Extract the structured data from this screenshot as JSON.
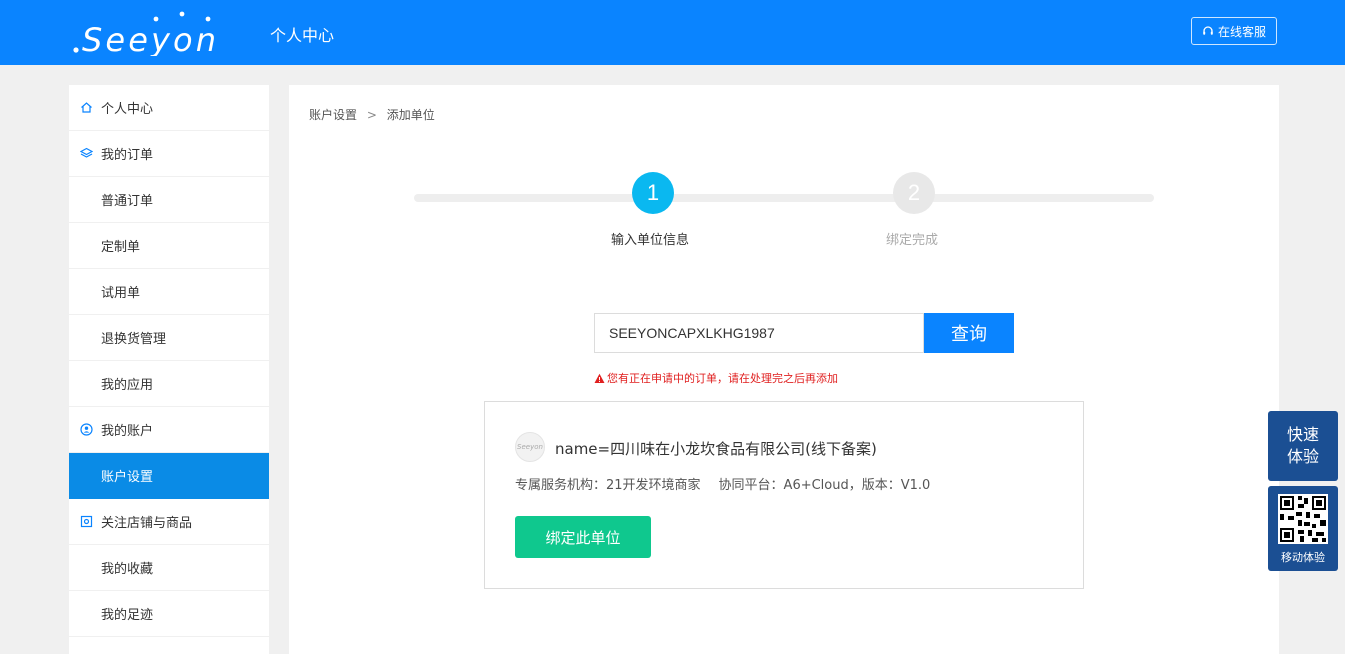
{
  "header": {
    "logo_text": ".Seeyon",
    "title": "个人中心",
    "support_label": "在线客服"
  },
  "sidebar": {
    "items": [
      {
        "label": "个人中心",
        "type": "group",
        "icon": "home-icon"
      },
      {
        "label": "我的订单",
        "type": "group",
        "icon": "layers-icon"
      },
      {
        "label": "普通订单",
        "type": "sub"
      },
      {
        "label": "定制单",
        "type": "sub"
      },
      {
        "label": "试用单",
        "type": "sub"
      },
      {
        "label": "退换货管理",
        "type": "sub"
      },
      {
        "label": "我的应用",
        "type": "sub"
      },
      {
        "label": "我的账户",
        "type": "group",
        "icon": "account-icon"
      },
      {
        "label": "账户设置",
        "type": "sub",
        "active": true
      },
      {
        "label": "关注店铺与商品",
        "type": "group",
        "icon": "store-icon"
      },
      {
        "label": "我的收藏",
        "type": "sub"
      },
      {
        "label": "我的足迹",
        "type": "sub"
      }
    ]
  },
  "breadcrumb": {
    "parent": "账户设置",
    "separator": ">",
    "current": "添加单位"
  },
  "steps": [
    {
      "number": "1",
      "label": "输入单位信息",
      "state": "active"
    },
    {
      "number": "2",
      "label": "绑定完成",
      "state": "pending"
    }
  ],
  "search": {
    "value": "SEEYONCAPXLKHG1987",
    "button_label": "查询"
  },
  "warning_text": "您有正在申请中的订单，请在处理完之后再添加",
  "result": {
    "logo_text": "Seeyon",
    "name": "name=四川味在小龙坎食品有限公司(线下备案)",
    "service_org": "专属服务机构：21开发环境商家",
    "platform": "协同平台：A6+Cloud，版本：V1.0",
    "bind_label": "绑定此单位"
  },
  "floating": {
    "quick_line1": "快速",
    "quick_line2": "体验",
    "mobile_label": "移动体验"
  },
  "colors": {
    "header_bg": "#0a84ff",
    "active_item_bg": "#0a8be6",
    "step_active": "#0ab8f0",
    "bind_button": "#0fc88e",
    "warning": "#e02020",
    "float_bg": "#1b4f93"
  }
}
